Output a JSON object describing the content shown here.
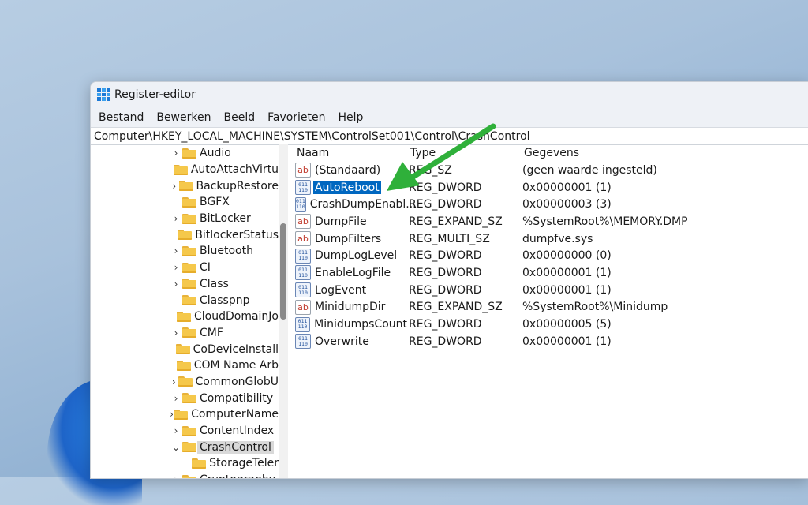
{
  "window": {
    "title": "Register-editor"
  },
  "menu": [
    "Bestand",
    "Bewerken",
    "Beeld",
    "Favorieten",
    "Help"
  ],
  "address": "Computer\\HKEY_LOCAL_MACHINE\\SYSTEM\\ControlSet001\\Control\\CrashControl",
  "tree": [
    {
      "label": "Audio",
      "expandable": true
    },
    {
      "label": "AutoAttachVirtu",
      "expandable": false
    },
    {
      "label": "BackupRestore",
      "expandable": true
    },
    {
      "label": "BGFX",
      "expandable": false
    },
    {
      "label": "BitLocker",
      "expandable": true
    },
    {
      "label": "BitlockerStatus",
      "expandable": false
    },
    {
      "label": "Bluetooth",
      "expandable": true
    },
    {
      "label": "CI",
      "expandable": true
    },
    {
      "label": "Class",
      "expandable": true
    },
    {
      "label": "Classpnp",
      "expandable": false
    },
    {
      "label": "CloudDomainJo",
      "expandable": false
    },
    {
      "label": "CMF",
      "expandable": true
    },
    {
      "label": "CoDeviceInstall",
      "expandable": false
    },
    {
      "label": "COM Name Arb",
      "expandable": false
    },
    {
      "label": "CommonGlobU",
      "expandable": true
    },
    {
      "label": "Compatibility",
      "expandable": true
    },
    {
      "label": "ComputerName",
      "expandable": true
    },
    {
      "label": "ContentIndex",
      "expandable": true
    },
    {
      "label": "CrashControl",
      "expanded": true,
      "selected": true
    },
    {
      "label": "StorageTeler",
      "child": true
    },
    {
      "label": "Cryptography",
      "expandable": true
    }
  ],
  "columns": {
    "name": "Naam",
    "type": "Type",
    "data": "Gegevens"
  },
  "values": [
    {
      "name": "(Standaard)",
      "type": "REG_SZ",
      "data": "(geen waarde ingesteld)",
      "icon": "string-value-icon"
    },
    {
      "name": "AutoReboot",
      "type": "REG_DWORD",
      "data": "0x00000001 (1)",
      "icon": "binary-value-icon",
      "selected": true
    },
    {
      "name": "CrashDumpEnabl...",
      "type": "REG_DWORD",
      "data": "0x00000003 (3)",
      "icon": "binary-value-icon"
    },
    {
      "name": "DumpFile",
      "type": "REG_EXPAND_SZ",
      "data": "%SystemRoot%\\MEMORY.DMP",
      "icon": "string-value-icon"
    },
    {
      "name": "DumpFilters",
      "type": "REG_MULTI_SZ",
      "data": "dumpfve.sys",
      "icon": "string-value-icon"
    },
    {
      "name": "DumpLogLevel",
      "type": "REG_DWORD",
      "data": "0x00000000 (0)",
      "icon": "binary-value-icon"
    },
    {
      "name": "EnableLogFile",
      "type": "REG_DWORD",
      "data": "0x00000001 (1)",
      "icon": "binary-value-icon"
    },
    {
      "name": "LogEvent",
      "type": "REG_DWORD",
      "data": "0x00000001 (1)",
      "icon": "binary-value-icon"
    },
    {
      "name": "MinidumpDir",
      "type": "REG_EXPAND_SZ",
      "data": "%SystemRoot%\\Minidump",
      "icon": "string-value-icon"
    },
    {
      "name": "MinidumpsCount",
      "type": "REG_DWORD",
      "data": "0x00000005 (5)",
      "icon": "binary-value-icon"
    },
    {
      "name": "Overwrite",
      "type": "REG_DWORD",
      "data": "0x00000001 (1)",
      "icon": "binary-value-icon"
    }
  ],
  "icons": {
    "string_glyph": "ab",
    "binary_glyph": [
      "011",
      "110"
    ]
  },
  "colors": {
    "selection": "#0067c0",
    "arrow": "#2fb03a"
  }
}
